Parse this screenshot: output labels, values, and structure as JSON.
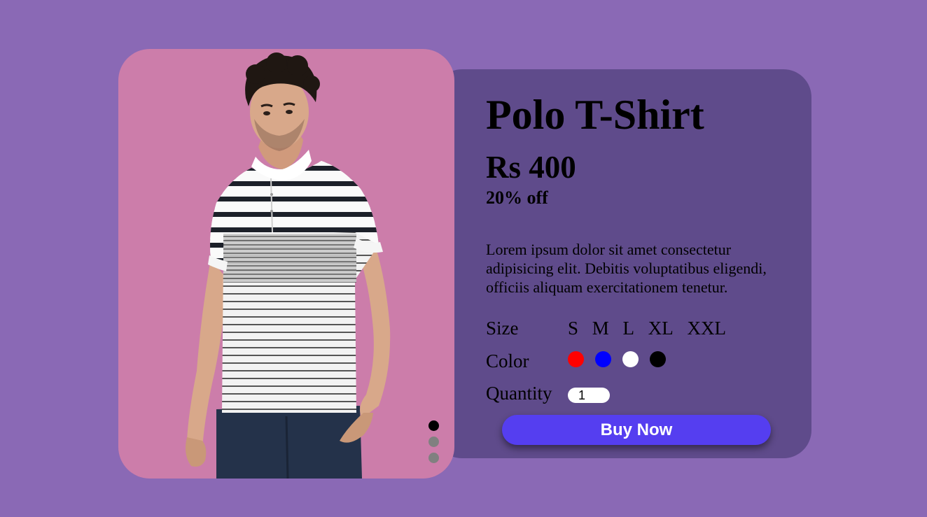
{
  "product": {
    "title": "Polo T-Shirt",
    "price": "Rs 400",
    "discount": "20% off",
    "description": "Lorem ipsum dolor sit amet consectetur adipisicing elit. Debitis voluptatibus eligendi, officiis aliquam exercitationem tenetur."
  },
  "options": {
    "size_label": "Size",
    "color_label": "Color",
    "quantity_label": "Quantity",
    "sizes": [
      "S",
      "M",
      "L",
      "XL",
      "XXL"
    ],
    "colors": [
      "#ff0000",
      "#0000ff",
      "#ffffff",
      "#000000"
    ],
    "quantity_value": "1"
  },
  "buy_button_label": "Buy Now",
  "slider": {
    "dots": 3,
    "active_index": 0
  },
  "colors": {
    "background": "#8a69b5",
    "image_card": "#cc7daa",
    "info_card": "#5f4b8b",
    "button": "#553ef0"
  },
  "icons": {
    "product_image": "man-wearing-striped-polo-shirt"
  }
}
